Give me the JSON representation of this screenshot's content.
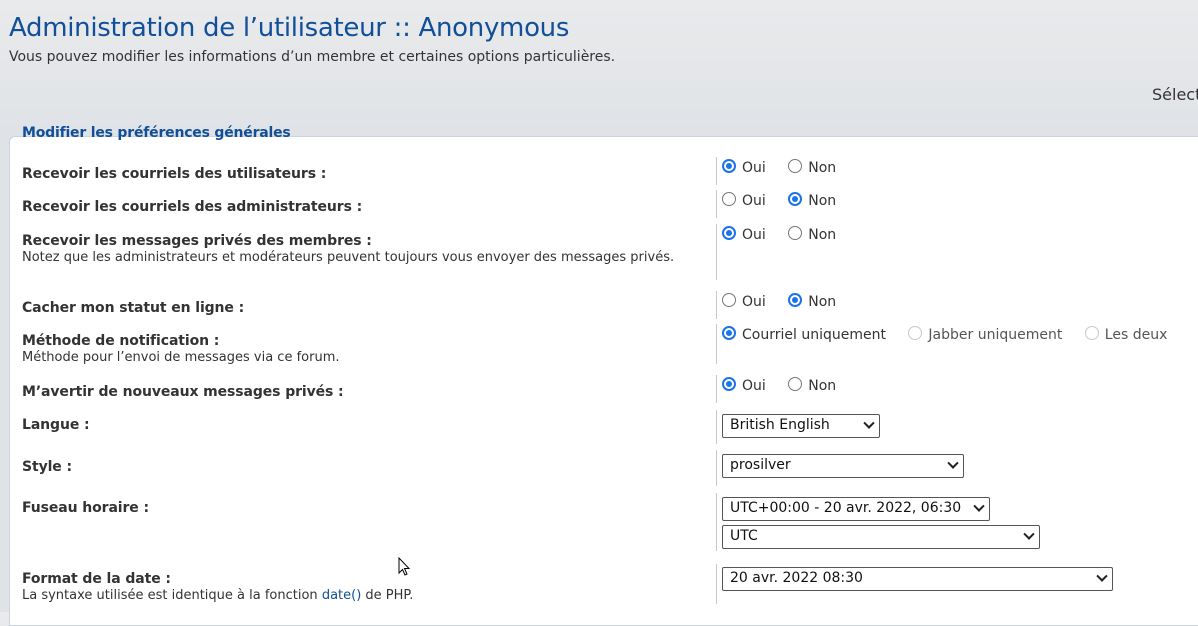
{
  "header": {
    "title": "Administration de l’utilisateur :: Anonymous",
    "subtitle": "Vous pouvez modifier les informations d’un membre et certaines options particulières.",
    "select_truncated": "Sélect"
  },
  "panel": {
    "legend": "Modifier les préférences générales",
    "rows": [
      {
        "label": "Recevoir les courriels des utilisateurs :",
        "options": [
          "Oui",
          "Non"
        ],
        "selected": "Oui"
      },
      {
        "label": "Recevoir les courriels des administrateurs :",
        "options": [
          "Oui",
          "Non"
        ],
        "selected": "Non"
      },
      {
        "label": "Recevoir les messages privés des membres :",
        "note": "Notez que les administrateurs et modérateurs peuvent toujours vous envoyer des messages privés.",
        "options": [
          "Oui",
          "Non"
        ],
        "selected": "Oui"
      },
      {
        "label": "Cacher mon statut en ligne :",
        "options": [
          "Oui",
          "Non"
        ],
        "selected": "Non"
      },
      {
        "label": "Méthode de notification :",
        "note": "Méthode pour l’envoi de messages via ce forum.",
        "options": [
          "Courriel uniquement",
          "Jabber uniquement",
          "Les deux"
        ],
        "selected": "Courriel uniquement",
        "disabled": [
          "Jabber uniquement",
          "Les deux"
        ]
      },
      {
        "label": "M’avertir de nouveaux messages privés :",
        "options": [
          "Oui",
          "Non"
        ],
        "selected": "Oui"
      },
      {
        "label": "Langue :",
        "select_value": "British English"
      },
      {
        "label": "Style :",
        "select_value": "prosilver"
      },
      {
        "label": "Fuseau horaire :",
        "select_value": "UTC+00:00 - 20 avr. 2022, 06:30",
        "select_value_2": "UTC"
      },
      {
        "label": "Format de la date :",
        "note_prefix": "La syntaxe utilisée est identique à la fonction ",
        "note_link": "date()",
        "note_suffix": " de PHP.",
        "select_value": "20 avr. 2022 08:30"
      }
    ]
  },
  "colors": {
    "accent": "#115098",
    "radio_selected": "#1a73e8"
  }
}
